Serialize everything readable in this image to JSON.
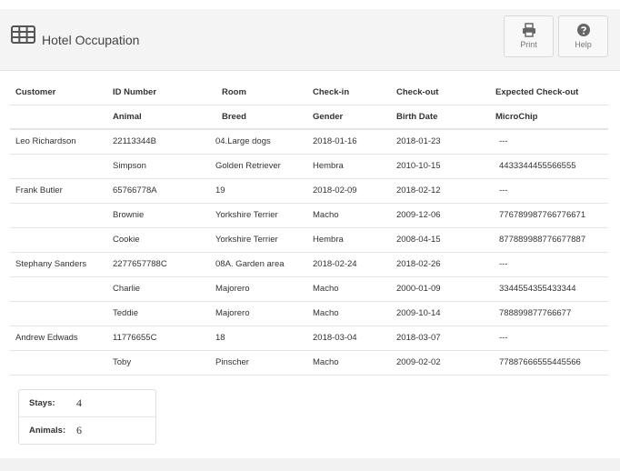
{
  "header": {
    "title": "Hotel Occupation",
    "print_label": "Print",
    "help_label": "Help"
  },
  "table": {
    "headers": [
      "Customer",
      "ID Number",
      "Room",
      "Check-in",
      "Check-out",
      "Expected Check-out"
    ],
    "subheaders": [
      "",
      "Animal",
      "Breed",
      "Gender",
      "Birth Date",
      "MicroChip"
    ],
    "rows": [
      {
        "kind": "customer",
        "cells": [
          "Leo Richardson",
          "22113344B",
          "04.Large dogs",
          "2018-01-16",
          "2018-01-23",
          "---"
        ]
      },
      {
        "kind": "animal",
        "cells": [
          "",
          "Simpson",
          "Golden Retriever",
          "Hembra",
          "2010-10-15",
          "4433344455566555"
        ]
      },
      {
        "kind": "customer",
        "cells": [
          "Frank Butler",
          "65766778A",
          "19",
          "2018-02-09",
          "2018-02-12",
          "---"
        ]
      },
      {
        "kind": "animal",
        "cells": [
          "",
          "Brownie",
          "Yorkshire Terrier",
          "Macho",
          "2009-12-06",
          "776789987766776671"
        ]
      },
      {
        "kind": "animal",
        "cells": [
          "",
          "Cookie",
          "Yorkshire Terrier",
          "Hembra",
          "2008-04-15",
          "877889988776677887"
        ]
      },
      {
        "kind": "customer",
        "cells": [
          "Stephany Sanders",
          "2277657788C",
          "08A. Garden area",
          "2018-02-24",
          "2018-02-26",
          "---"
        ]
      },
      {
        "kind": "animal",
        "cells": [
          "",
          "Charlie",
          "Majorero",
          "Macho",
          "2000-01-09",
          "3344554355433344"
        ]
      },
      {
        "kind": "animal",
        "cells": [
          "",
          "Teddie",
          "Majorero",
          "Macho",
          "2009-10-14",
          "788899877766677"
        ]
      },
      {
        "kind": "customer",
        "cells": [
          "Andrew Edwads",
          "11776655C",
          "18",
          "2018-03-04",
          "2018-03-07",
          "---"
        ]
      },
      {
        "kind": "animal",
        "cells": [
          "",
          "Toby",
          "Pinscher",
          "Macho",
          "2009-02-02",
          "77887666555445566"
        ]
      }
    ]
  },
  "summary": {
    "stays_label": "Stays:",
    "stays_value": "4",
    "animals_label": "Animals:",
    "animals_value": "6"
  },
  "colors": {
    "accent_green": "#7fa24f",
    "header_bg": "#f4f4f4"
  },
  "icons": {
    "title": "table-grid-icon",
    "print": "printer-icon",
    "help": "question-circle-icon"
  }
}
